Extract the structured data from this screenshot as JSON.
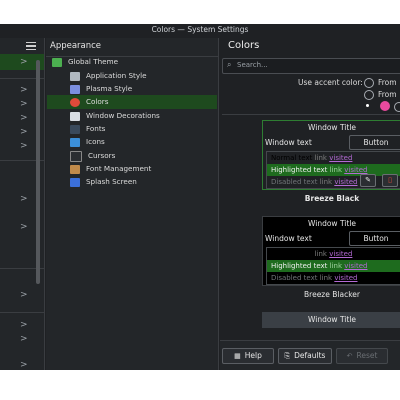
{
  "window": {
    "title": "Colors — System Settings"
  },
  "left": {
    "chevrons": [
      ">",
      ">",
      ">",
      ">",
      ">",
      ">",
      ">",
      ">",
      ">",
      ">",
      ">",
      ">"
    ]
  },
  "middle": {
    "heading": "Appearance",
    "items": [
      {
        "label": "Global Theme",
        "color": "#4caf50"
      },
      {
        "label": "Application Style",
        "color": "#b0b8c0"
      },
      {
        "label": "Plasma Style",
        "color": "#7b8fe0"
      },
      {
        "label": "Colors",
        "color": "#e04a3a"
      },
      {
        "label": "Window Decorations",
        "color": "#d8dde3"
      },
      {
        "label": "Fonts",
        "color": "#3a4a5c"
      },
      {
        "label": "Icons",
        "color": "#3b8fd9"
      },
      {
        "label": "Cursors",
        "color": "#2a2d31"
      },
      {
        "label": "Font Management",
        "color": "#c08a4a"
      },
      {
        "label": "Splash Screen",
        "color": "#3b6fd9"
      }
    ],
    "selected": "Colors"
  },
  "right": {
    "heading": "Colors",
    "search_placeholder": "Search...",
    "accent_label": "Use accent color:",
    "accent_options": [
      "From",
      "From"
    ],
    "accent_color": "#e84a9e",
    "schemes": [
      {
        "window_title": "Window Title",
        "window_text": "Window text",
        "button": "Button",
        "normal": "Normal text",
        "link": "link",
        "visited": "visited",
        "highlighted": "Highlighted text",
        "disabled": "Disabled text",
        "name": "Breeze Black"
      },
      {
        "window_title": "Window Title",
        "window_text": "Window text",
        "button": "Button",
        "normal": "Normal text",
        "link": "link",
        "visited": "visited",
        "highlighted": "Highlighted text",
        "disabled": "Disabled text",
        "name": "Breeze Blacker"
      },
      {
        "window_title": "Window Title"
      }
    ],
    "buttons": {
      "help": "Help",
      "defaults": "Defaults",
      "reset": "Reset"
    }
  }
}
